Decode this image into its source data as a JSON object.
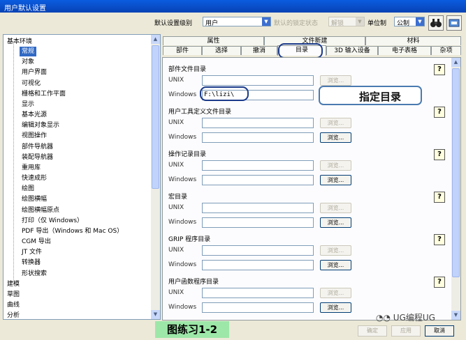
{
  "window": {
    "title": "用户默认设置"
  },
  "toolbar": {
    "level_label": "默认设置级别",
    "level_value": "用户",
    "lock_state_label": "默认的锁定状态",
    "lock_state_value": "解锁",
    "unit_label": "单位制",
    "unit_value": "公制"
  },
  "tree": {
    "root_label": "基本环境",
    "items": [
      "常规",
      "对象",
      "用户界面",
      "可视化",
      "栅格和工作平面",
      "显示",
      "基本光源",
      "编辑对象显示",
      "视图操作",
      "部件导航器",
      "装配导航器",
      "重用库",
      "快速成形",
      "绘图",
      "绘图横幅",
      "绘图横幅原点",
      "打印（仅 Windows）",
      "PDF 导出（Windows 和 Mac OS）",
      "CGM 导出",
      "JT 文件",
      "转换器",
      "形状搜索"
    ],
    "bottom_items": [
      "建模",
      "草图",
      "曲线",
      "分析"
    ]
  },
  "tabs": {
    "back_row": [
      "属性",
      "文件新建",
      "材料"
    ],
    "front_row": [
      "部件",
      "选择",
      "撤消",
      "目录",
      "3D 输入设备",
      "电子表格",
      "杂项"
    ],
    "active": "目录"
  },
  "sections": [
    {
      "title": "部件文件目录",
      "unix_label": "UNIX",
      "windows_label": "Windows",
      "unix_value": "",
      "windows_value": "F:\\lizi\\",
      "browse_label": "浏览..."
    },
    {
      "title": "用户工具定义文件目录",
      "unix_label": "UNIX",
      "windows_label": "Windows",
      "unix_value": "",
      "windows_value": "",
      "browse_label": "浏览..."
    },
    {
      "title": "操作记录目录",
      "unix_label": "UNIX",
      "windows_label": "Windows",
      "unix_value": "",
      "windows_value": "",
      "browse_label": "浏览..."
    },
    {
      "title": "宏目录",
      "unix_label": "UNIX",
      "windows_label": "Windows",
      "unix_value": "",
      "windows_value": "",
      "browse_label": "浏览..."
    },
    {
      "title": "GRIP 程序目录",
      "unix_label": "UNIX",
      "windows_label": "Windows",
      "unix_value": "",
      "windows_value": "",
      "browse_label": "浏览..."
    },
    {
      "title": "用户函数程序目录",
      "unix_label": "UNIX",
      "windows_label": "Windows",
      "unix_value": "",
      "windows_value": "",
      "browse_label": "浏览..."
    }
  ],
  "help_glyph": "?",
  "annotations": {
    "callout": "指定目录",
    "exercise": "图练习1-2",
    "watermark": "UG编程UG"
  },
  "bottom_buttons": [
    "确定",
    "应用",
    "取消"
  ],
  "colors": {
    "title_bar": "#0a5ce0",
    "selection": "#316ac5",
    "exercise_bg": "#9de7a8"
  }
}
